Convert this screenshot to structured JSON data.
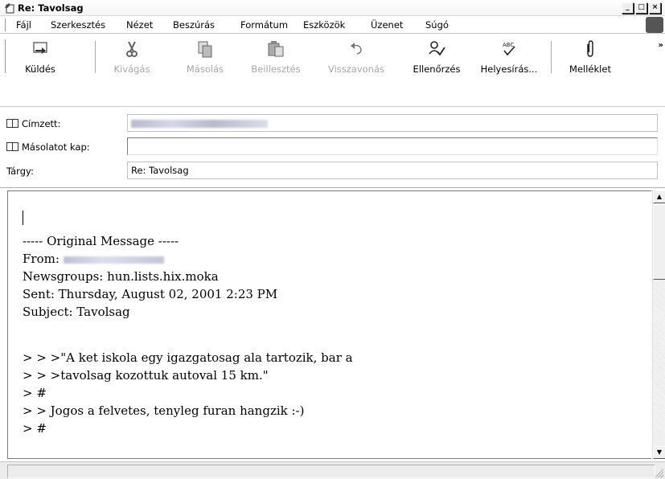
{
  "window": {
    "title": "Re: Tavolsag"
  },
  "menu": [
    "Fájl",
    "Szerkesztés",
    "Nézet",
    "Beszúrás",
    "Formátum",
    "Eszközök",
    "Üzenet",
    "Súgó"
  ],
  "toolbar": {
    "send": "Küldés",
    "cut": "Kivágás",
    "copy": "Másolás",
    "paste": "Beillesztés",
    "undo": "Visszavonás",
    "check": "Ellenőrzés",
    "spell": "Helyesírás...",
    "attach": "Melléklet",
    "more": "»"
  },
  "fields": {
    "to_label": "Címzett:",
    "cc_label": "Másolatot kap:",
    "subject_label": "Tárgy:",
    "subject_value": "Re: Tavolsag",
    "cc_value": ""
  },
  "body": {
    "lines": [
      "----- Original Message -----",
      "From:",
      "Newsgroups: hun.lists.hix.moka",
      "Sent: Thursday, August 02, 2001 2:23 PM",
      "Subject: Tavolsag",
      "",
      "> > >\"A ket iskola egy igazgatosag ala tartozik, bar a",
      "> > >tavolsag kozottuk autoval 15 km.\"",
      "> #",
      "> > Jogos a felvetes, tenyleg furan hangzik :-)",
      "> #"
    ]
  },
  "icons": {
    "send": "send-icon",
    "cut": "scissors-icon",
    "copy": "copy-icon",
    "paste": "paste-icon",
    "undo": "undo-icon",
    "check": "check-names-icon",
    "spell": "spellcheck-icon",
    "attach": "paperclip-icon"
  }
}
